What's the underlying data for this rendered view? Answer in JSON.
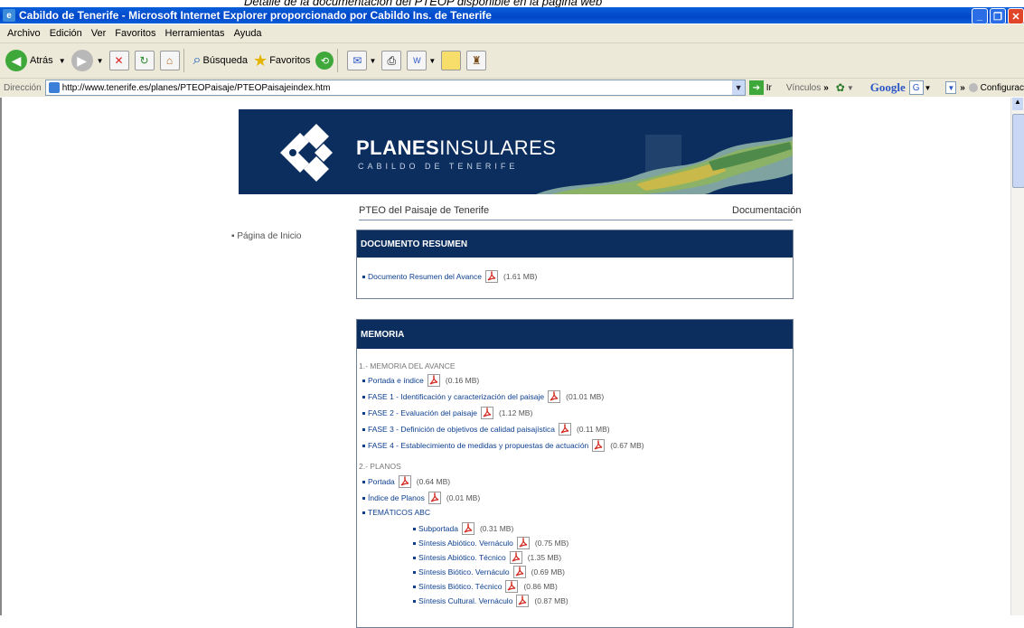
{
  "caption": "Detalle de la documentación del PTEOP disponible en la página web",
  "window": {
    "title": "Cabildo de Tenerife - Microsoft Internet Explorer proporcionado por Cabildo Ins. de Tenerife"
  },
  "menu": [
    "Archivo",
    "Edición",
    "Ver",
    "Favoritos",
    "Herramientas",
    "Ayuda"
  ],
  "toolbar": {
    "back": "Atrás",
    "search": "Búsqueda",
    "favorites": "Favoritos"
  },
  "address": {
    "label": "Dirección",
    "url": "http://www.tenerife.es/planes/PTEOPaisaje/PTEOPaisajeindex.htm",
    "go": "Ir",
    "links": "Vínculos",
    "google": "Google",
    "config": "Configurac"
  },
  "banner": {
    "brand_bold": "PLANES",
    "brand_light": "INSULARES",
    "subtitle": "CABILDO DE TENERIFE"
  },
  "page": {
    "title": "PTEO del Paisaje de Tenerife",
    "section_link": "Documentación",
    "home": "Página de Inicio"
  },
  "resumen": {
    "header": "DOCUMENTO RESUMEN",
    "items": [
      {
        "label": "Documento Resumen del Avance",
        "size": "(1.61 MB)"
      }
    ]
  },
  "memoria": {
    "header": "MEMORIA",
    "sections": [
      {
        "title": "1.- MEMORIA DEL AVANCE",
        "items": [
          {
            "label": "Portada e índice",
            "size": "(0.16 MB)"
          },
          {
            "label": "FASE 1 - Identificación y caracterización del paisaje",
            "size": "(01.01 MB)"
          },
          {
            "label": "FASE 2 - Evaluación del paisaje",
            "size": "(1.12 MB)"
          },
          {
            "label": "FASE 3 - Definición de objetivos de calidad paisajística",
            "size": "(0.11 MB)"
          },
          {
            "label": "FASE 4 - Establecimiento de medidas y propuestas de actuación",
            "size": "(0.67 MB)"
          }
        ]
      },
      {
        "title": "2.- PLANOS",
        "items": [
          {
            "label": "Portada",
            "size": "(0.64 MB)"
          },
          {
            "label": "Índice de Planos",
            "size": "(0.01 MB)"
          },
          {
            "label": "TEMÁTICOS ABC",
            "size": ""
          }
        ],
        "subitems": [
          {
            "label": "Subportada",
            "size": "(0.31 MB)"
          },
          {
            "label": "Síntesis Abiótico. Vernáculo",
            "size": "(0.75 MB)"
          },
          {
            "label": "Síntesis Abiótico. Técnico",
            "size": "(1.35 MB)"
          },
          {
            "label": "Síntesis Biótico. Vernáculo",
            "size": "(0.69 MB)"
          },
          {
            "label": "Síntesis Biótico. Técnico",
            "size": "(0.86 MB)"
          },
          {
            "label": "Síntesis Cultural. Vernáculo",
            "size": "(0.87 MB)"
          }
        ]
      }
    ]
  },
  "colors": {
    "brand": "#0c2e5e",
    "link": "#0d3f8f",
    "pdf": "#d2281e"
  }
}
